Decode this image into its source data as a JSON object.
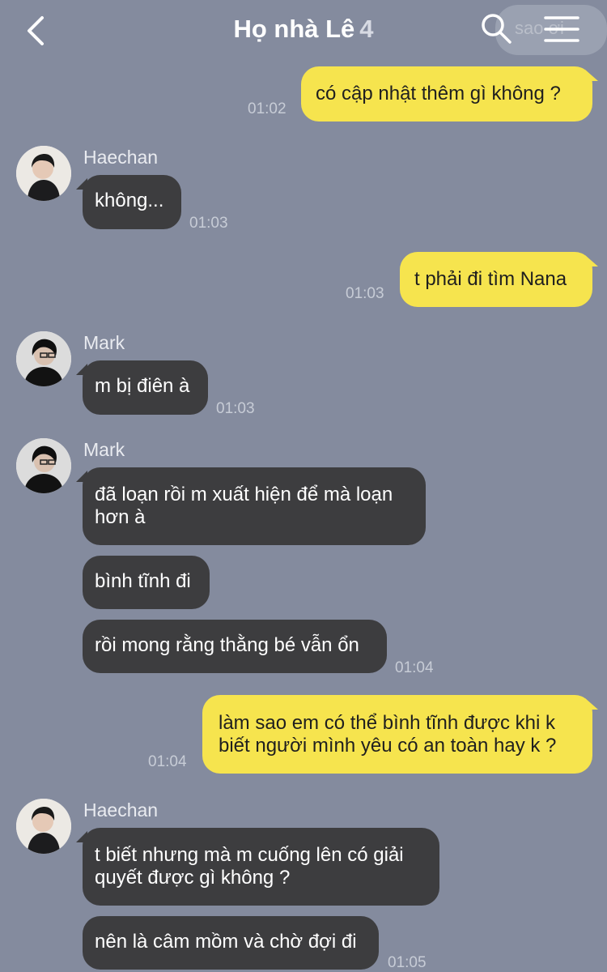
{
  "header": {
    "title": "Họ nhà Lê",
    "member_count": "4",
    "ghost_text": "sao ơi"
  },
  "messages": [
    {
      "text": "có cập nhật thêm gì không ?",
      "time": "01:02"
    },
    {
      "sender": "Haechan",
      "text": "không...",
      "time": "01:03"
    },
    {
      "text": "t phải đi tìm Nana",
      "time": "01:03"
    },
    {
      "sender": "Mark",
      "text": "m bị điên à",
      "time": "01:03"
    },
    {
      "sender": "Mark",
      "text": "đã loạn rồi m xuất hiện để mà loạn hơn à"
    },
    {
      "text": "bình tĩnh đi"
    },
    {
      "text": "rồi mong rằng thằng bé vẫn ổn",
      "time": "01:04"
    },
    {
      "text": "làm sao em có thể bình tĩnh được khi k biết người mình yêu có an toàn hay k ?",
      "time": "01:04"
    },
    {
      "sender": "Haechan",
      "text": "t biết nhưng mà m cuống lên có giải quyết được gì không ?"
    },
    {
      "text": "nên là câm mồm và chờ đợi đi",
      "time": "01:05"
    }
  ]
}
